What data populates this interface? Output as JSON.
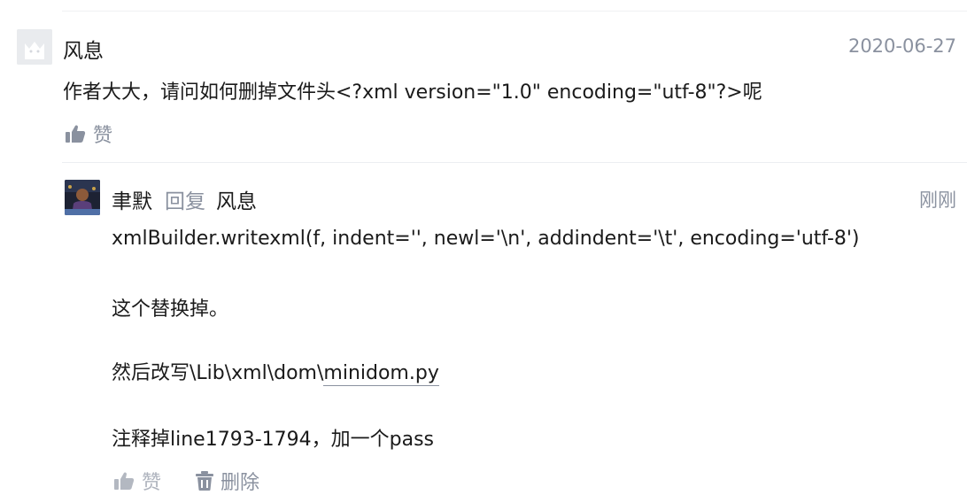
{
  "comment": {
    "author": "风息",
    "date": "2020-06-27",
    "text": "作者大大，请问如何删掉文件头<?xml version=\"1.0\" encoding=\"utf-8\"?>呢",
    "like_label": "赞"
  },
  "reply": {
    "author": "聿默",
    "reply_word": "回复",
    "reply_to": "风息",
    "time": "刚刚",
    "line1": "xmlBuilder.writexml(f, indent='', newl='\\n', addindent='\\t', encoding='utf-8')",
    "line2": "这个替换掉。",
    "line3_prefix": "然后改写\\Lib\\xml\\dom\\",
    "line3_link": "minidom.py",
    "line4": "注释掉line1793-1794，加一个pass",
    "like_label": "赞",
    "delete_label": "删除"
  },
  "icons": [
    "thumbs-up-icon",
    "trash-icon"
  ],
  "colors": {
    "text": "#1a1a1a",
    "muted": "#8a919f",
    "divider": "#eceef1"
  }
}
